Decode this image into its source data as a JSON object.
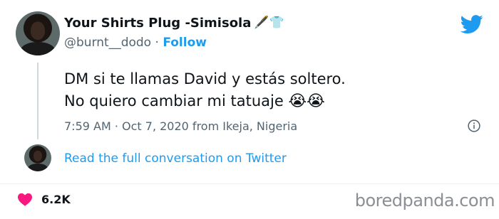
{
  "author": {
    "display_name": "Your Shirts Plug -Simisola",
    "name_emojis": "🖋️👕",
    "handle": "@burnt__dodo",
    "separator": "·",
    "follow_label": "Follow"
  },
  "tweet": {
    "line1": "DM si te llamas David y estás soltero.",
    "line2": "No quiero cambiar mi tatuaje",
    "line2_emojis": "😭😭",
    "timestamp": "7:59 AM · Oct 7, 2020 from Ikeja, Nigeria"
  },
  "conversation_link": "Read the full conversation on Twitter",
  "likes_count": "6.2K",
  "watermark": "boredpanda.com",
  "colors": {
    "brand": "#1d9bf0",
    "heart": "#f91880",
    "secondary_text": "#536471"
  }
}
